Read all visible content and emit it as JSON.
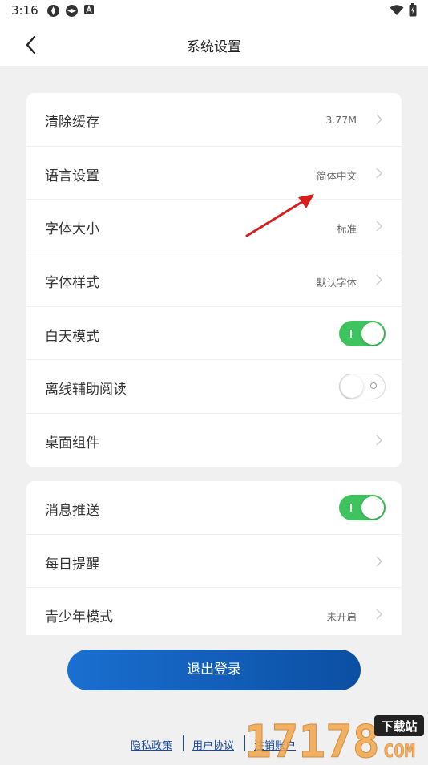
{
  "status_bar": {
    "time": "3:16",
    "left_icons": [
      "app-icon",
      "app-icon",
      "text-a-icon"
    ],
    "right_icons": [
      "wifi-icon",
      "battery-icon"
    ]
  },
  "header": {
    "title": "系统设置",
    "back_icon": "chevron-left-icon"
  },
  "settings_group_1": {
    "rows": [
      {
        "label": "清除缓存",
        "value": "3.77M"
      },
      {
        "label": "语言设置",
        "value": "简体中文"
      },
      {
        "label": "字体大小",
        "value": "标准"
      },
      {
        "label": "字体样式",
        "value": "默认字体"
      },
      {
        "label": "白天模式",
        "toggle": "on"
      },
      {
        "label": "离线辅助阅读",
        "toggle": "off"
      },
      {
        "label": "桌面组件",
        "value": ""
      }
    ]
  },
  "settings_group_2": {
    "rows": [
      {
        "label": "消息推送",
        "toggle": "on"
      },
      {
        "label": "每日提醒",
        "value": ""
      },
      {
        "label": "青少年模式",
        "value": "未开启"
      }
    ]
  },
  "logout_button": "退出登录",
  "footer": {
    "links": [
      "隐私政策",
      "用户协议",
      "注销账户"
    ]
  },
  "watermark": {
    "brand": "17178",
    "tag": "下载站",
    "domain": "COM"
  },
  "colors": {
    "toggle_on": "#3fc35e",
    "logout_start": "#1a6fd0",
    "logout_end": "#0b4fa3",
    "link": "#1a4aa0",
    "annotation_arrow": "#d61f1f"
  }
}
